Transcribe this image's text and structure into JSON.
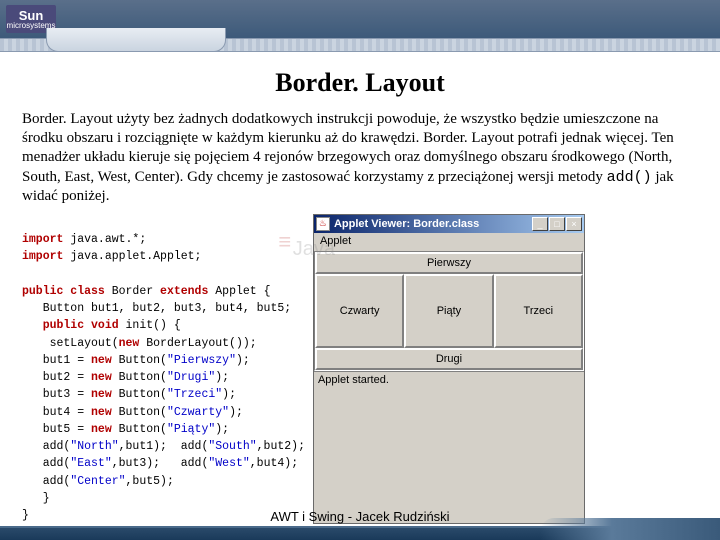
{
  "logo": {
    "top": "Sun",
    "bottom": "microsystems"
  },
  "title": "Border. Layout",
  "paragraph_parts": {
    "p1": "Border. Layout użyty bez żadnych dodatkowych instrukcji powoduje, że wszystko będzie  umieszczone na środku obszaru i rozciągnięte w każdym kierunku aż do krawędzi. Border. Layout potrafi jednak więcej. Ten menadżer układu kieruje się pojęciem 4 rejonów brzegowych oraz domyślnego obszaru środkowego (North, South, East, West, Center). Gdy chcemy je zastosować korzystamy z przeciążonej wersji metody ",
    "code": "add()",
    "p2": " jak widać poniżej."
  },
  "code": {
    "l1a": "import",
    "l1b": " java.awt.*;",
    "l2a": "import",
    "l2b": " java.applet.Applet;",
    "l3a": "public class",
    "l3b": " Border ",
    "l3c": "extends",
    "l3d": " Applet {",
    "l4": "   Button but1, but2, but3, but4, but5;",
    "l5a": "   public void",
    "l5b": " init() {",
    "l6a": "    setLayout(",
    "l6b": "new",
    "l6c": " BorderLayout());",
    "l7a": "   but1 = ",
    "l7b": "new",
    "l7c": " Button(",
    "l7d": "\"Pierwszy\"",
    "l7e": ");",
    "l8a": "   but2 = ",
    "l8b": "new",
    "l8c": " Button(",
    "l8d": "\"Drugi\"",
    "l8e": ");",
    "l9a": "   but3 = ",
    "l9b": "new",
    "l9c": " Button(",
    "l9d": "\"Trzeci\"",
    "l9e": ");",
    "l10a": "   but4 = ",
    "l10b": "new",
    "l10c": " Button(",
    "l10d": "\"Czwarty\"",
    "l10e": ");",
    "l11a": "   but5 = ",
    "l11b": "new",
    "l11c": " Button(",
    "l11d": "\"Piąty\"",
    "l11e": ");",
    "l12a": "   add(",
    "l12b": "\"North\"",
    "l12c": ",but1);  add(",
    "l12d": "\"South\"",
    "l12e": ",but2);",
    "l13a": "   add(",
    "l13b": "\"East\"",
    "l13c": ",but3);   add(",
    "l13d": "\"West\"",
    "l13e": ",but4);",
    "l14a": "   add(",
    "l14b": "\"Center\"",
    "l14c": ",but5);",
    "l15": "   }",
    "l16": "}"
  },
  "watermark": "Java",
  "applet": {
    "title": "Applet Viewer: Border.class",
    "menu": "Applet",
    "north": "Pierwszy",
    "south": "Drugi",
    "east": "Trzeci",
    "west": "Czwarty",
    "center": "Piąty",
    "status": "Applet started.",
    "min": "_",
    "max": "□",
    "close": "×"
  },
  "footer": "AWT i Swing - Jacek Rudziński"
}
